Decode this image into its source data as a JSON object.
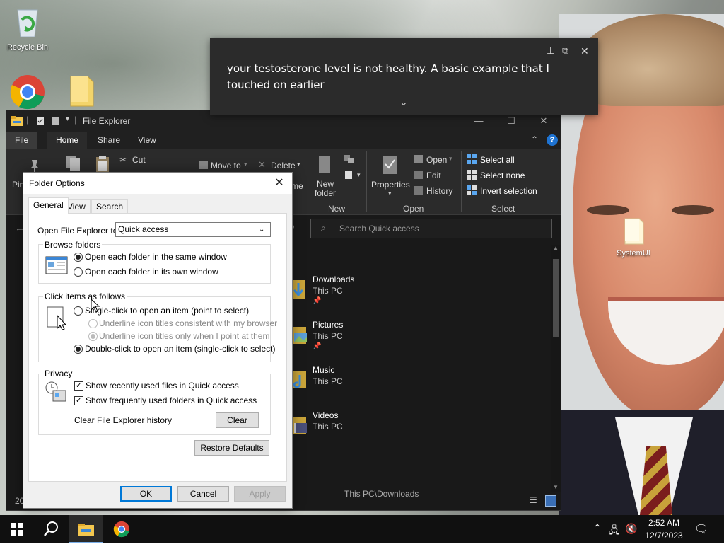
{
  "desktop": {
    "icons": [
      {
        "label": "Recycle Bin",
        "icon": "recycle-bin-icon"
      },
      {
        "label": "",
        "icon": "chrome-icon"
      },
      {
        "label": "",
        "icon": "folder-icon"
      },
      {
        "label": "SystemUI",
        "icon": "folder-icon"
      }
    ]
  },
  "notification": {
    "text": "your testosterone level is not healthy. A basic example that I touched on earlier"
  },
  "explorer": {
    "title": "File Explorer",
    "tabs": [
      "File",
      "Home",
      "Share",
      "View"
    ],
    "ribbon": {
      "pin_label": "Pin",
      "cut_label": "Cut",
      "move_to_label": "Move to",
      "delete_label": "Delete",
      "rename_frag": "me",
      "new_folder_label": "New\nfolder",
      "properties_label": "Properties",
      "open_label": "Open",
      "edit_label": "Edit",
      "history_label": "History",
      "select_all_label": "Select all",
      "select_none_label": "Select none",
      "invert_selection_label": "Invert selection",
      "group_new": "New",
      "group_open": "Open",
      "group_select": "Select"
    },
    "search_placeholder": "Search Quick access",
    "quick_access": [
      {
        "name": "Downloads",
        "location": "This PC",
        "pinned": true
      },
      {
        "name": "Pictures",
        "location": "This PC",
        "pinned": true
      },
      {
        "name": "Music",
        "location": "This PC",
        "pinned": false
      },
      {
        "name": "Videos",
        "location": "This PC",
        "pinned": false
      }
    ],
    "status_fragment": "This PC\\Downloads",
    "status_items": "20"
  },
  "folder_options": {
    "title": "Folder Options",
    "tabs": [
      "General",
      "View",
      "Search"
    ],
    "open_to_label": "Open File Explorer to:",
    "open_to_value": "Quick access",
    "browse_folders": {
      "label": "Browse folders",
      "same_window": "Open each folder in the same window",
      "own_window": "Open each folder in its own window"
    },
    "click_items": {
      "label": "Click items as follows",
      "single_click": "Single-click to open an item (point to select)",
      "underline_browser": "Underline icon titles consistent with my browser",
      "underline_point": "Underline icon titles only when I point at them",
      "double_click": "Double-click to open an item (single-click to select)"
    },
    "privacy": {
      "label": "Privacy",
      "recent_files": "Show recently used files in Quick access",
      "frequent_folders": "Show frequently used folders in Quick access",
      "clear_history_label": "Clear File Explorer history",
      "clear_button": "Clear"
    },
    "restore_defaults": "Restore Defaults",
    "ok": "OK",
    "cancel": "Cancel",
    "apply": "Apply"
  },
  "taskbar": {
    "time": "2:52 AM",
    "date": "12/7/2023"
  },
  "colors": {
    "accent": "#0078d7",
    "explorer_bg": "#191919",
    "taskbar_bg": "#101010"
  }
}
